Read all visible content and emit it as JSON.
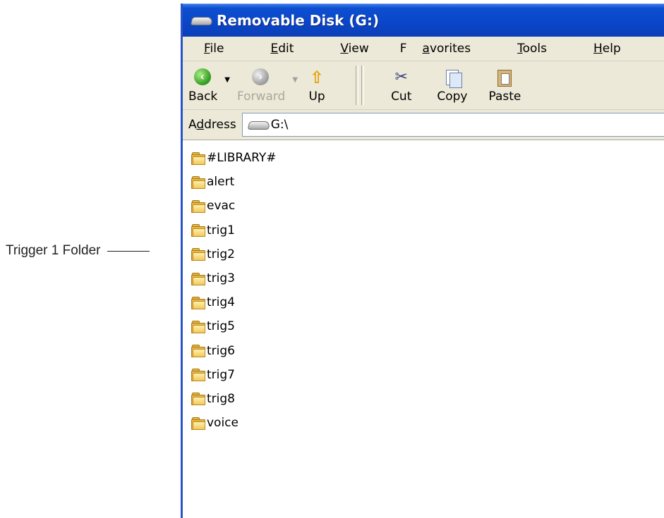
{
  "callout": {
    "label": "Trigger 1 Folder"
  },
  "window": {
    "title": "Removable Disk (G:)"
  },
  "menu": [
    {
      "pre": "",
      "key": "F",
      "post": "ile"
    },
    {
      "pre": "",
      "key": "E",
      "post": "dit"
    },
    {
      "pre": "",
      "key": "V",
      "post": "iew"
    },
    {
      "pre": "F",
      "key": "a",
      "post": "vorites"
    },
    {
      "pre": "",
      "key": "T",
      "post": "ools"
    },
    {
      "pre": "",
      "key": "H",
      "post": "elp"
    }
  ],
  "toolbar": {
    "back": "Back",
    "forward": "Forward",
    "up": "Up",
    "cut": "Cut",
    "copy": "Copy",
    "paste": "Paste"
  },
  "address": {
    "label_pre": "A",
    "label_key": "d",
    "label_post": "dress",
    "value": "G:\\"
  },
  "files": [
    "#LIBRARY#",
    "alert",
    "evac",
    "trig1",
    "trig2",
    "trig3",
    "trig4",
    "trig5",
    "trig6",
    "trig7",
    "trig8",
    "voice"
  ],
  "colors": {
    "titlebar": "#0a45c8",
    "chrome": "#ece9d8",
    "folder": "#eab84a"
  }
}
